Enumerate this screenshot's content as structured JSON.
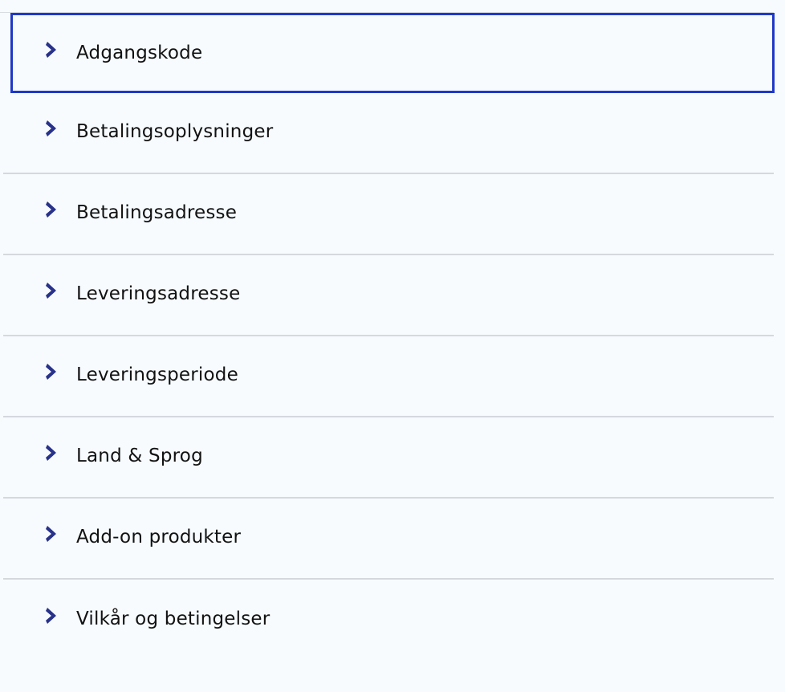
{
  "colors": {
    "background": "#f7fbfe",
    "chevron": "#28328a",
    "focus_outline": "#2038c8",
    "divider": "#d5d9de",
    "text": "#121212"
  },
  "menu": {
    "items": [
      {
        "label": "Adgangskode",
        "icon": "chevron-right-icon",
        "focused": true
      },
      {
        "label": "Betalingsoplysninger",
        "icon": "chevron-right-icon"
      },
      {
        "label": "Betalingsadresse",
        "icon": "chevron-right-icon"
      },
      {
        "label": "Leveringsadresse",
        "icon": "chevron-right-icon"
      },
      {
        "label": "Leveringsperiode",
        "icon": "chevron-right-icon"
      },
      {
        "label": "Land & Sprog",
        "icon": "chevron-right-icon"
      },
      {
        "label": "Add-on produkter",
        "icon": "chevron-right-icon"
      },
      {
        "label": "Vilkår og betingelser",
        "icon": "chevron-right-icon"
      }
    ]
  }
}
